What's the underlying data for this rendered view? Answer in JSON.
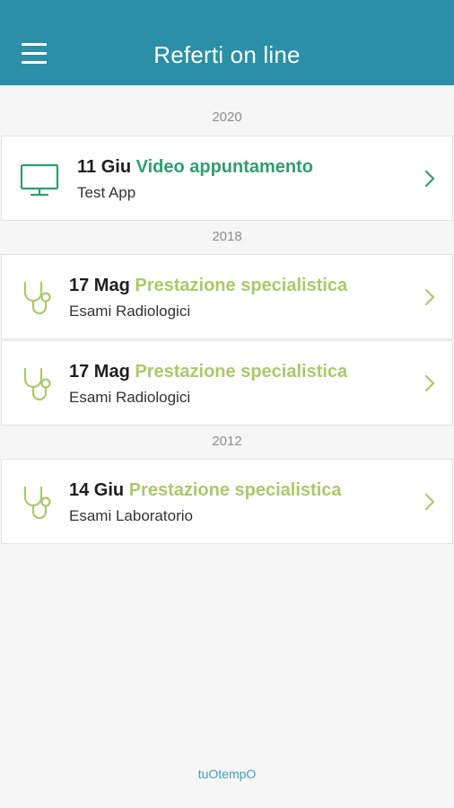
{
  "header": {
    "title": "Referti on line",
    "menu_icon": "hamburger-menu-icon"
  },
  "colors": {
    "header_bg": "#2b8fa8",
    "video_accent": "#2f9e6e",
    "spec_accent": "#aac96a",
    "footer_link": "#3aa0c0"
  },
  "groups": [
    {
      "year": "2020",
      "items": [
        {
          "date": "11 Giu",
          "type": "Video appuntamento",
          "subtitle": "Test App",
          "icon": "monitor-icon"
        }
      ]
    },
    {
      "year": "2018",
      "items": [
        {
          "date": "17 Mag",
          "type": "Prestazione specialistica",
          "subtitle": "Esami Radiologici",
          "icon": "stethoscope-icon"
        },
        {
          "date": "17 Mag",
          "type": "Prestazione specialistica",
          "subtitle": "Esami Radiologici",
          "icon": "stethoscope-icon"
        }
      ]
    },
    {
      "year": "2012",
      "items": [
        {
          "date": "14 Giu",
          "type": "Prestazione specialistica",
          "subtitle": "Esami Laboratorio",
          "icon": "stethoscope-icon"
        }
      ]
    }
  ],
  "footer": {
    "brand": "tuOtempO"
  }
}
